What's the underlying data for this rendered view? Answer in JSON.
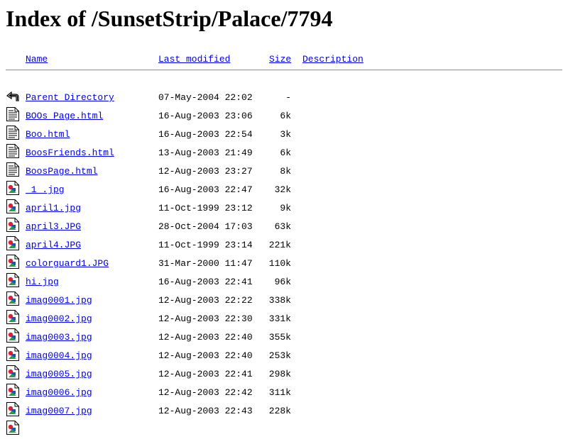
{
  "page": {
    "title": "Index of /SunsetStrip/Palace/7794"
  },
  "columns": {
    "name": "Name",
    "last_modified": "Last modified",
    "size": "Size",
    "description": "Description"
  },
  "rows": [
    {
      "icon": "back",
      "name": "Parent Directory",
      "modified": "07-May-2004 22:02",
      "size": "-"
    },
    {
      "icon": "text",
      "name": "BOOs Page.html",
      "modified": "16-Aug-2003 23:06",
      "size": "6k"
    },
    {
      "icon": "text",
      "name": "Boo.html",
      "modified": "16-Aug-2003 22:54",
      "size": "3k"
    },
    {
      "icon": "text",
      "name": "BoosFriends.html",
      "modified": "13-Aug-2003 21:49",
      "size": "6k"
    },
    {
      "icon": "text",
      "name": "BoosPage.html",
      "modified": "12-Aug-2003 23:27",
      "size": "8k"
    },
    {
      "icon": "image",
      "name": "_1_.jpg",
      "modified": "16-Aug-2003 22:47",
      "size": "32k"
    },
    {
      "icon": "image",
      "name": "april1.jpg",
      "modified": "11-Oct-1999 23:12",
      "size": "9k"
    },
    {
      "icon": "image",
      "name": "april3.JPG",
      "modified": "28-Oct-2004 17:03",
      "size": "63k"
    },
    {
      "icon": "image",
      "name": "april4.JPG",
      "modified": "11-Oct-1999 23:14",
      "size": "221k"
    },
    {
      "icon": "image",
      "name": "colorguard1.JPG",
      "modified": "31-Mar-2000 11:47",
      "size": "110k"
    },
    {
      "icon": "image",
      "name": "hi.jpg",
      "modified": "16-Aug-2003 22:41",
      "size": "96k"
    },
    {
      "icon": "image",
      "name": "imag0001.jpg",
      "modified": "12-Aug-2003 22:22",
      "size": "338k"
    },
    {
      "icon": "image",
      "name": "imag0002.jpg",
      "modified": "12-Aug-2003 22:30",
      "size": "331k"
    },
    {
      "icon": "image",
      "name": "imag0003.jpg",
      "modified": "12-Aug-2003 22:40",
      "size": "355k"
    },
    {
      "icon": "image",
      "name": "imag0004.jpg",
      "modified": "12-Aug-2003 22:40",
      "size": "253k"
    },
    {
      "icon": "image",
      "name": "imag0005.jpg",
      "modified": "12-Aug-2003 22:41",
      "size": "298k"
    },
    {
      "icon": "image",
      "name": "imag0006.jpg",
      "modified": "12-Aug-2003 22:42",
      "size": "311k"
    },
    {
      "icon": "image",
      "name": "imag0007.jpg",
      "modified": "12-Aug-2003 22:43",
      "size": "228k"
    },
    {
      "icon": "image",
      "name": "",
      "modified": "",
      "size": ""
    }
  ]
}
